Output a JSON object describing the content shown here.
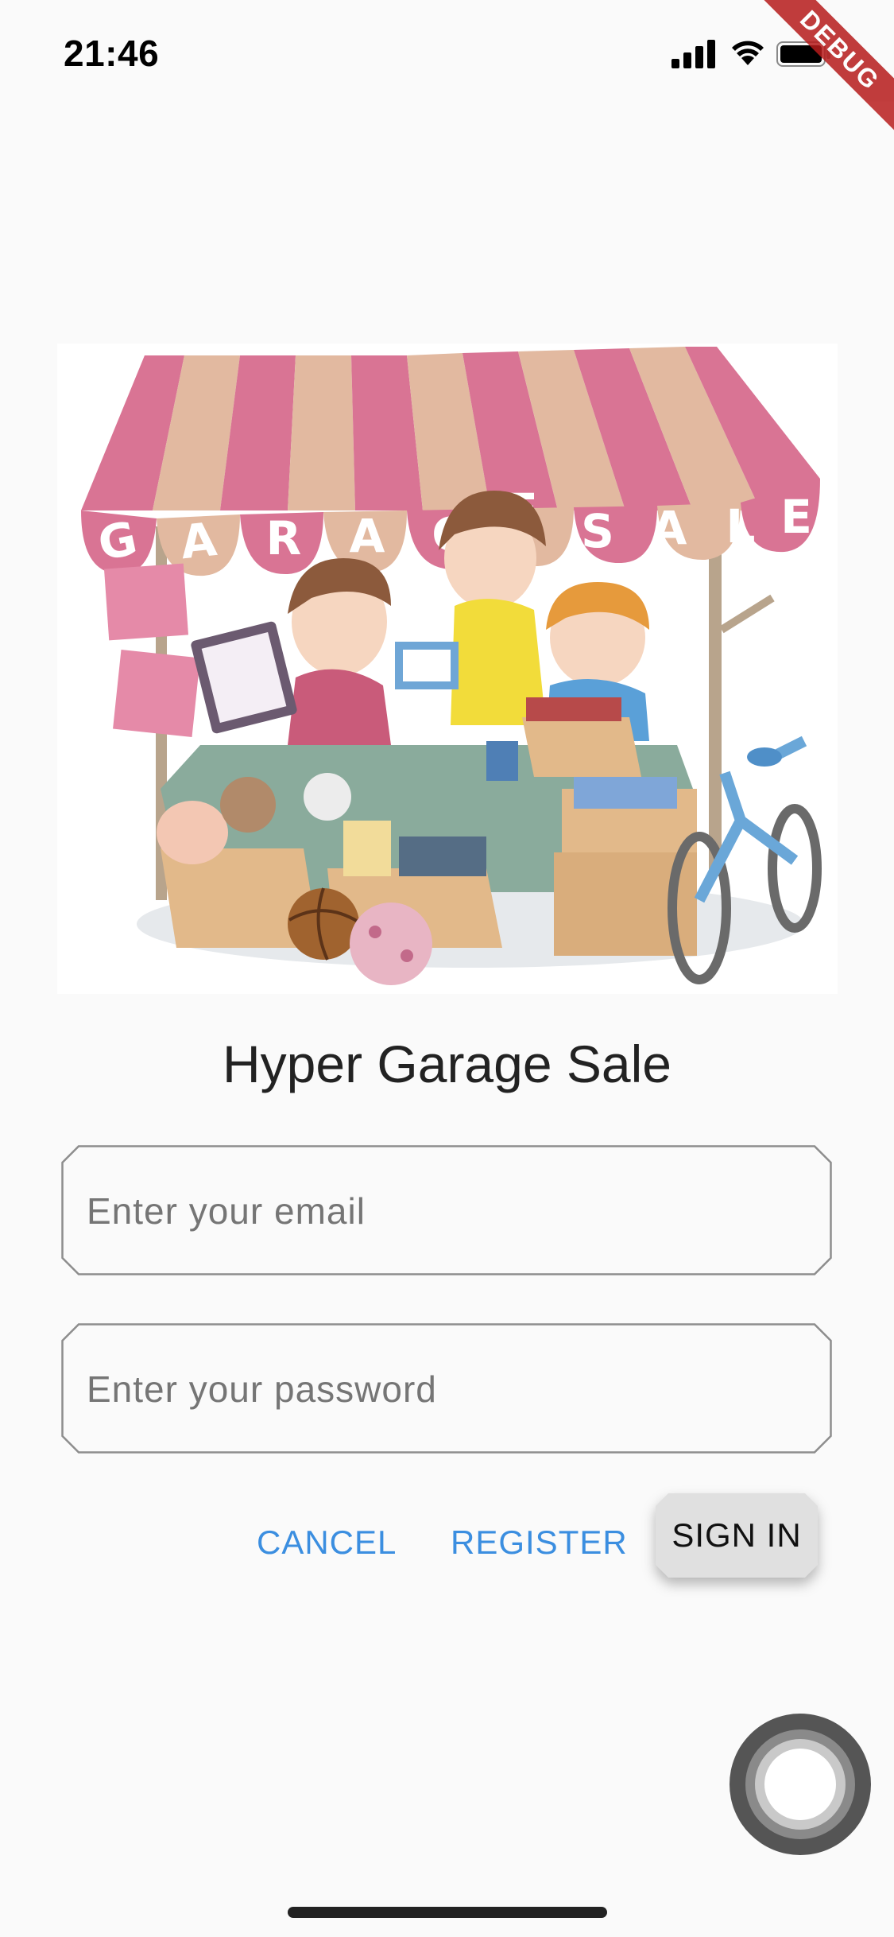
{
  "status_bar": {
    "time": "21:46"
  },
  "debug_banner": "DEBUG",
  "hero": {
    "banner_letters": [
      "G",
      "A",
      "R",
      "A",
      "G",
      "E",
      "S",
      "A",
      "L",
      "E"
    ]
  },
  "app_title": "Hyper Garage Sale",
  "form": {
    "email_placeholder": "Enter your email",
    "password_placeholder": "Enter your password"
  },
  "actions": {
    "cancel_label": "CANCEL",
    "register_label": "REGISTER",
    "sign_in_label": "SIGN IN"
  },
  "colors": {
    "accent": "#3b8ee0",
    "background": "#fafafa",
    "awning_pink": "#d97494",
    "awning_tan": "#e2b9a0"
  },
  "icons": [
    "signal-icon",
    "wifi-icon",
    "battery-icon",
    "assistive-touch-icon"
  ]
}
